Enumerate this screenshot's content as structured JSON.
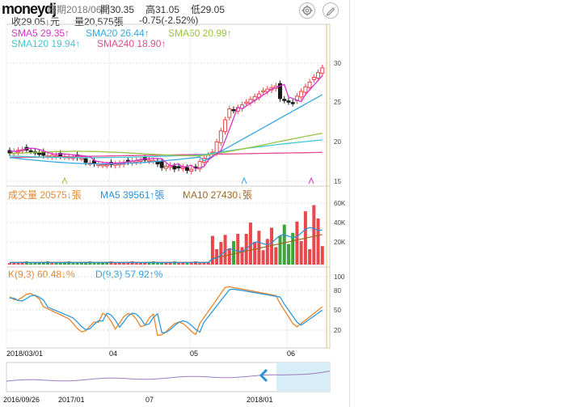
{
  "header": {
    "logo_text": "moneydj",
    "date_text": "日期2018/06/",
    "open_label": "開30.35",
    "high_label": "高31.05",
    "low_label": "低29.05",
    "close_label": "收29.05↓元",
    "volume_label": "量20,575張",
    "change_label": "-0.75(-2.52%)"
  },
  "icons": {
    "settings": "gear-icon",
    "edit": "pencil-icon"
  },
  "price_panel": {
    "ma": [
      {
        "label": "SMA5 29.35↑",
        "color": "#d932c9"
      },
      {
        "label": "SMA20 26.44↑",
        "color": "#35a8df"
      },
      {
        "label": "SMA60 20.99↑",
        "color": "#9cc33f"
      },
      {
        "label": "SMA120 19.94↑",
        "color": "#43c7d1"
      },
      {
        "label": "SMA240 18.90↑",
        "color": "#e44a8e"
      }
    ],
    "y_ticks": [
      "30",
      "25",
      "20",
      "15"
    ]
  },
  "volume_panel": {
    "ma": [
      {
        "label": "成交量 20575↓張",
        "color": "#e08a33"
      },
      {
        "label": "MA5 39561↑張",
        "color": "#2c8fd6"
      },
      {
        "label": "MA10 27430↓張",
        "color": "#a0651e"
      }
    ],
    "y_ticks": [
      "60K",
      "40K",
      "20K"
    ]
  },
  "kd_panel": {
    "ma": [
      {
        "label": "K(9,3) 60.48↓%",
        "color": "#e8862a"
      },
      {
        "label": "D(9,3) 57.92↑%",
        "color": "#2c9be0"
      }
    ],
    "y_ticks": [
      "100",
      "80",
      "50",
      "20"
    ]
  },
  "x_axis": {
    "dates": [
      "2018/03/01",
      "04",
      "05",
      "06"
    ]
  },
  "overview": {
    "dates": [
      "2016/09/26",
      "2017/01",
      "07",
      "2018/01"
    ]
  },
  "colors": {
    "up": "#e8474c",
    "down": "#1a1a1a",
    "vol_up": "#e8474c",
    "vol_down": "#3fa33d"
  }
}
